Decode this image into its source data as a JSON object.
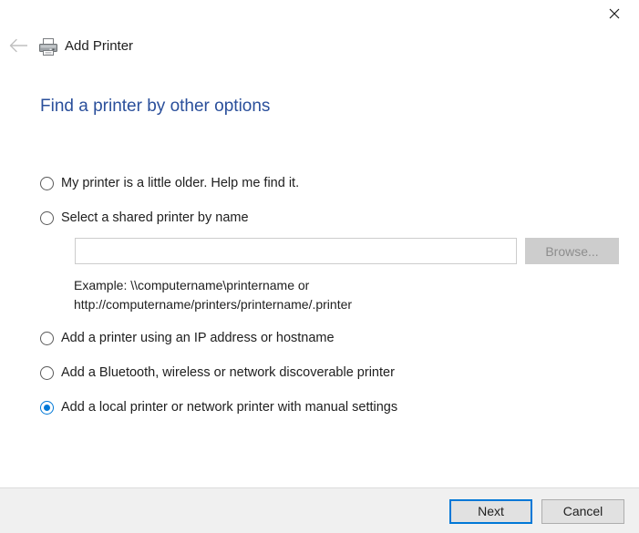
{
  "window": {
    "title": "Add Printer",
    "close_label": "✕",
    "back_label": "←",
    "printer_icon": "printer-icon",
    "close_icon": "close-icon",
    "back_icon": "back-arrow-icon"
  },
  "page": {
    "heading": "Find a printer by other options"
  },
  "options": [
    {
      "id": "older-printer",
      "label": "My printer is a little older. Help me find it.",
      "checked": false
    },
    {
      "id": "shared-printer",
      "label": "Select a shared printer by name",
      "checked": false
    },
    {
      "id": "ip-hostname",
      "label": "Add a printer using an IP address or hostname",
      "checked": false
    },
    {
      "id": "bluetooth-wireless",
      "label": "Add a Bluetooth, wireless or network discoverable printer",
      "checked": false
    },
    {
      "id": "local-manual",
      "label": "Add a local printer or network printer with manual settings",
      "checked": true
    }
  ],
  "shared_printer": {
    "value": "",
    "placeholder": "",
    "browse_label": "Browse...",
    "browse_disabled": true,
    "example_text": "Example: \\\\computername\\printername or\nhttp://computername/printers/printername/.printer"
  },
  "footer": {
    "next_label": "Next",
    "cancel_label": "Cancel"
  },
  "colors": {
    "heading_blue": "#2a4f9b",
    "accent_blue": "#0078d7",
    "footer_bg": "#f0f0f0",
    "text": "#202020",
    "disabled_text": "#8d8d8d",
    "button_bg": "#e1e1e1",
    "browse_bg": "#cdcdcd"
  }
}
